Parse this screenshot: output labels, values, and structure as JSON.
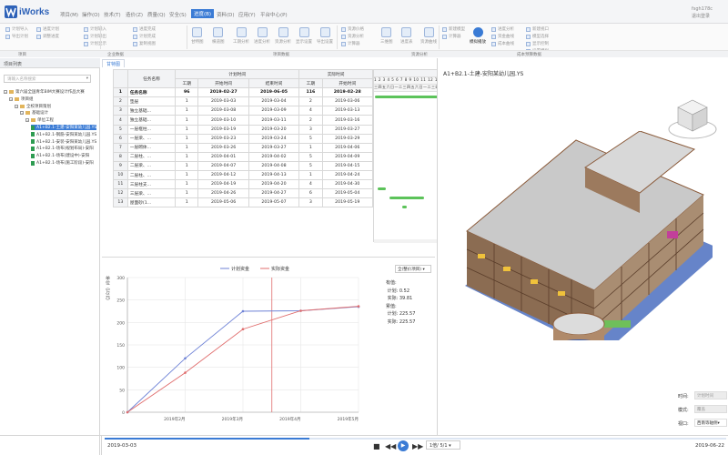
{
  "app": {
    "name": "iWorks"
  },
  "menu": [
    "项目(M)",
    "操作(O)",
    "技术(T)",
    "造价(Z)",
    "质量(Q)",
    "安全(S)",
    "进度(B)",
    "资料(D)",
    "应用(Y)",
    "平台中心(P)"
  ],
  "menu_active_index": 6,
  "user": {
    "name": "fsgh178c",
    "action": "退出登录"
  },
  "ribbon": {
    "groups": [
      "项目",
      "企业数据",
      "项目数据",
      "资源分析",
      "成本预算数据"
    ],
    "small_buttons_a": [
      "计划导入",
      "导出计划"
    ],
    "small_buttons_b": [
      "进度计划",
      "调整进度"
    ],
    "small_buttons_c": [
      "计划输入",
      "计划输出",
      "计划显示"
    ],
    "small_buttons_d": [
      "进度完成",
      "计划完成",
      "复制视图"
    ],
    "big_buttons": [
      "甘特图",
      "横道图",
      "工期分析",
      "进度分析",
      "资源分析",
      "显示设置",
      "导出设置"
    ],
    "small_buttons_e": [
      "资源价格",
      "资源分析",
      "计算器"
    ],
    "big_buttons_2": [
      "三维图",
      "进度表",
      "资源曲线"
    ],
    "small_buttons_f": [
      "新建模型",
      "计算器"
    ],
    "play_button": "模拟播放",
    "small_buttons_g": [
      "进度分析",
      "资金曲线",
      "成本曲线"
    ],
    "small_buttons_h": [
      "新建视口",
      "模型选择",
      "显示控制",
      "设置模拟"
    ]
  },
  "left_panel": {
    "title": "项目列表",
    "search_placeholder": "请输入名称搜索",
    "tree": [
      {
        "label": "第六届全国青年BIM大赛设计作品大赛",
        "level": 0
      },
      {
        "label": "项目组",
        "level": 1
      },
      {
        "label": "全校项目策划",
        "level": 2
      },
      {
        "label": "基础设计",
        "level": 3
      },
      {
        "label": "单位工程",
        "level": 4
      },
      {
        "label": "A1+B2.1-土建-安阳某幼儿园.YS",
        "level": 5,
        "selected": true
      },
      {
        "label": "A1+B2.1-钢筋-安阳某幼儿园.YS",
        "level": 5
      },
      {
        "label": "A1+B2.1-安装-安阳某幼儿园.YS",
        "level": 5
      },
      {
        "label": "A1+B2.1-场布(规划布局)-安阳",
        "level": 5
      },
      {
        "label": "A1+B2.1-场布(建设中)-安阳",
        "level": 5
      },
      {
        "label": "A1+B2.1-场布(施工阶段)-安阳",
        "level": 5
      }
    ]
  },
  "gantt": {
    "tab": "甘特图",
    "headers": {
      "name": "任务名称",
      "plan": "计划时间",
      "actual": "实际时间",
      "duration": "工期",
      "start": "开始时间",
      "end": "结束时间",
      "actual_start": "开始时间"
    },
    "rows": [
      {
        "idx": "1",
        "name": "任务名称",
        "dur": "96",
        "start": "2019-02-27",
        "end": "2019-06-05",
        "adur": "116",
        "astart": "2019-02-28"
      },
      {
        "idx": "2",
        "name": "垫层",
        "dur": "1",
        "start": "2019-03-03",
        "end": "2019-03-04",
        "adur": "2",
        "astart": "2019-03-06"
      },
      {
        "idx": "3",
        "name": "独立基础...",
        "dur": "1",
        "start": "2019-03-08",
        "end": "2019-03-09",
        "adur": "4",
        "astart": "2019-03-13"
      },
      {
        "idx": "4",
        "name": "独立基础...",
        "dur": "1",
        "start": "2019-03-10",
        "end": "2019-03-11",
        "adur": "2",
        "astart": "2019-03-16"
      },
      {
        "idx": "5",
        "name": "一层框柱...",
        "dur": "1",
        "start": "2019-03-19",
        "end": "2019-03-20",
        "adur": "3",
        "astart": "2019-03-27"
      },
      {
        "idx": "6",
        "name": "一层梁、...",
        "dur": "1",
        "start": "2019-03-23",
        "end": "2019-03-24",
        "adur": "5",
        "astart": "2019-03-29"
      },
      {
        "idx": "7",
        "name": "一层砌体...",
        "dur": "1",
        "start": "2019-03-26",
        "end": "2019-03-27",
        "adur": "1",
        "astart": "2019-04-06"
      },
      {
        "idx": "8",
        "name": "二层柱、...",
        "dur": "1",
        "start": "2019-04-01",
        "end": "2019-04-02",
        "adur": "5",
        "astart": "2019-04-09"
      },
      {
        "idx": "9",
        "name": "二层梁、...",
        "dur": "1",
        "start": "2019-04-07",
        "end": "2019-04-08",
        "adur": "5",
        "astart": "2019-04-15"
      },
      {
        "idx": "10",
        "name": "二层柱、...",
        "dur": "1",
        "start": "2019-04-12",
        "end": "2019-04-13",
        "adur": "1",
        "astart": "2019-04-24"
      },
      {
        "idx": "11",
        "name": "三层柱支...",
        "dur": "1",
        "start": "2019-04-19",
        "end": "2019-04-20",
        "adur": "4",
        "astart": "2019-04-30"
      },
      {
        "idx": "12",
        "name": "三层梁、...",
        "dur": "1",
        "start": "2019-04-26",
        "end": "2019-04-27",
        "adur": "6",
        "astart": "2019-05-04"
      },
      {
        "idx": "13",
        "name": "屋面砂(1...",
        "dur": "1",
        "start": "2019-05-06",
        "end": "2019-05-07",
        "adur": "3",
        "astart": "2019-05-19"
      }
    ],
    "chart_title": "2019年05月",
    "days": "1 2 3 4 5 6 7 8 9 10 11 12 13 14 15 16 17 18 19 20 21 22 23 24 25 26 2",
    "weekdays": "三四五六日一二三四五六日一二三四五六日一二三四五六日一二三四五",
    "bars": [
      {
        "row": 1,
        "start": 0,
        "len": 0.52,
        "color": "#5cc35a"
      },
      {
        "row": 1,
        "start": 0.55,
        "len": 0.45,
        "color": "#3a7bd5"
      },
      {
        "row": 11,
        "start": 0.02,
        "len": 0.05,
        "color": "#5cc35a"
      },
      {
        "row": 12,
        "start": 0.09,
        "len": 0.22,
        "color": "#5cc35a"
      },
      {
        "row": 13,
        "start": 0.17,
        "len": 0.03,
        "color": "#5cc35a"
      },
      {
        "row": 13,
        "start": 0.66,
        "len": 0.11,
        "color": "#f2c14e"
      }
    ]
  },
  "chart": {
    "legend": [
      "计划资金",
      "实际资金"
    ],
    "y_label": "单位（万元）",
    "dropdown": "全(整价项目)",
    "info": {
      "group1": "有值:",
      "plan1_label": "计划:",
      "plan1_value": "0.52",
      "actual1_label": "实际:",
      "actual1_value": "39.81",
      "group2": "累值:",
      "plan2_label": "计划:",
      "plan2_value": "225.57",
      "actual2_label": "实际:",
      "actual2_value": "225.57"
    }
  },
  "chart_data": {
    "type": "line",
    "categories": [
      "2019年2月",
      "2019年3月",
      "2019年4月",
      "2019年5月"
    ],
    "ylim": [
      0,
      300
    ],
    "yticks": [
      0,
      50,
      100,
      150,
      200,
      250,
      300
    ],
    "series": [
      {
        "name": "计划资金",
        "color": "#6e82d6",
        "values": [
          0,
          120,
          225,
          226,
          235
        ]
      },
      {
        "name": "实际资金",
        "color": "#e06d6d",
        "values": [
          0,
          88,
          185,
          226,
          236
        ]
      }
    ],
    "x_positions": [
      0,
      1,
      2,
      3,
      4
    ],
    "marker_x": 2.5
  },
  "viewport": {
    "title": "A1+B2.1-土建-安阳某幼儿园.YS",
    "time_label": "时间:",
    "time_value": "计划时间",
    "mode_label": "模式:",
    "mode_value": "覆盖",
    "view_label": "视口:",
    "view_value": "西南等轴侧"
  },
  "playback": {
    "start_date": "2019-03-03",
    "end_date": "2019-06-22",
    "speed": "1倍/ 5/1",
    "progress": 0.33
  },
  "colors": {
    "accent": "#3a7bd5"
  }
}
